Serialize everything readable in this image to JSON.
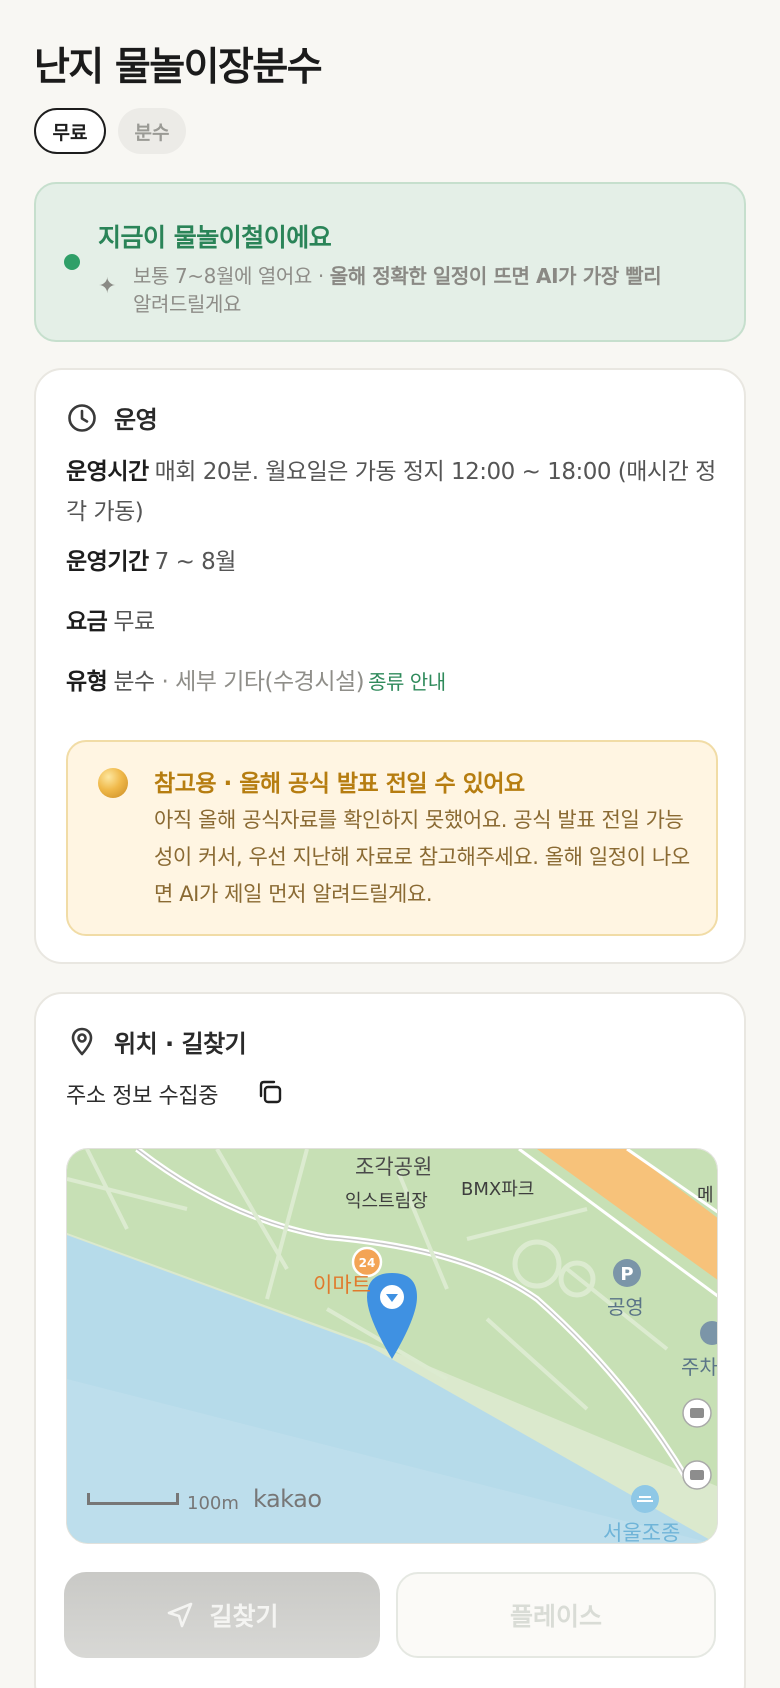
{
  "header": {
    "title": "난지 물놀이장분수",
    "chips": [
      "무료",
      "분수"
    ]
  },
  "season_banner": {
    "title": "지금이 물놀이철이에요",
    "text_normal": "보통 7~8월에 열어요 · ",
    "text_emphasis": "올해 정확한 일정이 뜨면 AI가 가장 빨리",
    "text_tail": "알려드릴게요",
    "accent_color": "#2f9f68"
  },
  "operation": {
    "section_title": "운영",
    "icon": "clock-icon",
    "hours_label": "운영시간",
    "hours_value": "매회 20분. 월요일은 가동 정지 12:00 ~ 18:00 (매시간 정각 가동)",
    "period_label": "운영기간",
    "period_value": "7 ~ 8월",
    "fee_label": "요금",
    "fee_value": "무료",
    "type_label": "유형",
    "type_value": "분수",
    "type_detail": " · 세부 기타(수경시설)",
    "type_link": "종류 안내",
    "notice": {
      "title": "참고용 · 올해 공식 발표 전일 수 있어요",
      "text": "아직 올해 공식자료를 확인하지 못했어요. 공식 발표 전일 가능성이 커서, 우선 지난해 자료로 참고해주세요. 올해 일정이 나오면 AI가 제일 먼저 알려드릴게요.",
      "accent_color": "#b67d10"
    }
  },
  "location": {
    "section_title": "위치 · 길찾기",
    "icon": "map-pin-icon",
    "address": "주소 정보 수집중",
    "copy_icon": "copy-icon",
    "map": {
      "labels": {
        "park": "조각공원",
        "extreme": "익스트림장",
        "bmx": "BMX파크",
        "emart": "이마트",
        "parking": "공영",
        "parking_symbol": "P",
        "me": "메",
        "ju": "주차",
        "seoul": "서울조종",
        "emart_symbol": "24"
      },
      "scale": "100m",
      "brand": "kakao"
    }
  },
  "actions": {
    "route_label": "길찾기",
    "places_label": "플레이스"
  }
}
